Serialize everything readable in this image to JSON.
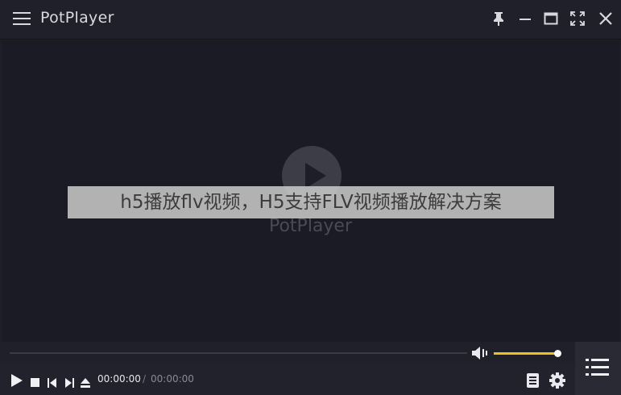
{
  "app": {
    "title": "PotPlayer"
  },
  "video": {
    "logo_text": "PotPlayer",
    "overlay_text": "h5播放flv视频，H5支持FLV视频播放解决方案"
  },
  "controls": {
    "current_time": "00:00:00",
    "separator": "/",
    "total_time": "00:00:00"
  },
  "colors": {
    "accent": "#f0c020",
    "background": "#1e1e29"
  }
}
